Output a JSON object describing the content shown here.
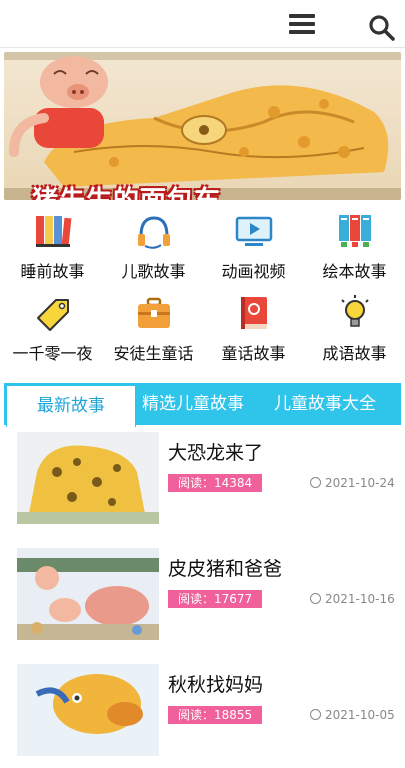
{
  "header": {
    "menu_icon": "menu-icon",
    "search_icon": "search-icon"
  },
  "banner": {
    "title": "猪先生的面包车"
  },
  "categories": [
    {
      "label": "睡前故事",
      "icon": "books-icon"
    },
    {
      "label": "儿歌故事",
      "icon": "headphones-icon"
    },
    {
      "label": "动画视频",
      "icon": "tv-play-icon"
    },
    {
      "label": "绘本故事",
      "icon": "picture-book-icon"
    },
    {
      "label": "一千零一夜",
      "icon": "tag-icon"
    },
    {
      "label": "安徒生童话",
      "icon": "briefcase-icon"
    },
    {
      "label": "童话故事",
      "icon": "book-icon"
    },
    {
      "label": "成语故事",
      "icon": "lightbulb-icon"
    }
  ],
  "tabs": {
    "active": "最新故事",
    "t2": "精选儿童故事",
    "t3": "儿童故事大全"
  },
  "stories": [
    {
      "title": "大恐龙来了",
      "reads": "阅读：14384",
      "date": "2021-10-24"
    },
    {
      "title": "皮皮猪和爸爸",
      "reads": "阅读：17677",
      "date": "2021-10-16"
    },
    {
      "title": "秋秋找妈妈",
      "reads": "阅读：18855",
      "date": "2021-10-05"
    }
  ],
  "colors": {
    "accent": "#2fc4ea",
    "badge": "#f0609a"
  }
}
